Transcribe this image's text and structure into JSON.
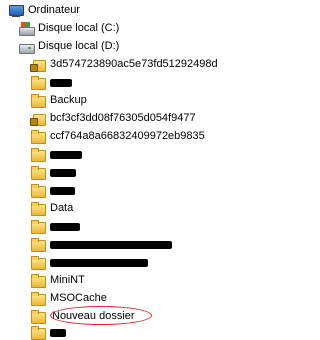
{
  "tree": {
    "root": {
      "label": "Ordinateur",
      "icon": "computer-icon"
    },
    "drives": [
      {
        "label": "Disque local (C:)",
        "icon": "drive-icon"
      },
      {
        "label": "Disque local (D:)",
        "icon": "drive-icon"
      }
    ],
    "folders": [
      {
        "label": "3d574723890ac5e73fd51292498d",
        "icon": "locked-folder-icon"
      },
      {
        "label": "",
        "icon": "folder-icon",
        "redacted": true
      },
      {
        "label": "Backup",
        "icon": "folder-icon"
      },
      {
        "label": "bcf3cf3dd08f76305d054f9477",
        "icon": "locked-folder-icon"
      },
      {
        "label": "ccf764a8a66832409972eb9835",
        "icon": "folder-icon"
      },
      {
        "label": "",
        "icon": "folder-icon",
        "redacted": true
      },
      {
        "label": "",
        "icon": "folder-icon",
        "redacted": true
      },
      {
        "label": "",
        "icon": "folder-icon",
        "redacted": true
      },
      {
        "label": "Data",
        "icon": "folder-icon"
      },
      {
        "label": "",
        "icon": "folder-icon",
        "redacted": true
      },
      {
        "label": "",
        "icon": "folder-icon",
        "redacted": true
      },
      {
        "label": "",
        "icon": "folder-icon",
        "redacted": true
      },
      {
        "label": "MiniNT",
        "icon": "folder-icon"
      },
      {
        "label": "MSOCache",
        "icon": "folder-icon"
      },
      {
        "label": "Nouveau dossier",
        "icon": "folder-icon",
        "highlighted": true
      },
      {
        "label": "",
        "icon": "folder-icon",
        "redacted": true
      }
    ],
    "highlight_color": "#e0242c"
  }
}
